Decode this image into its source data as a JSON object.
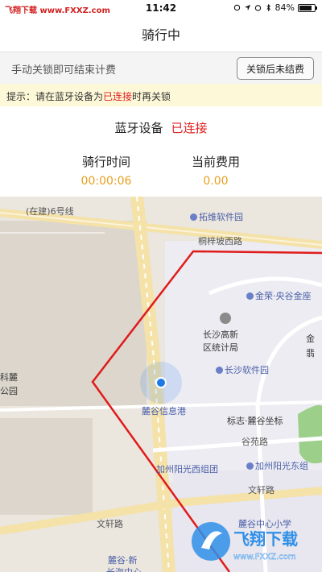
{
  "status_bar": {
    "carrier": "飞翔下载 www.FXXZ.com",
    "time": "11:42",
    "battery_text": "84%",
    "battery_level": 0.84
  },
  "nav": {
    "title": "骑行中"
  },
  "unlock": {
    "hint": "手动关锁即可结束计费",
    "button_label": "关锁后未结费"
  },
  "tip": {
    "prefix": "提示：请在蓝牙设备为",
    "highlight": "已连接",
    "suffix": "时再关锁"
  },
  "bluetooth": {
    "label": "蓝牙设备",
    "status": "已连接"
  },
  "ride": {
    "time_label": "骑行时间",
    "time_value": "00:00:06",
    "fee_label": "当前费用",
    "fee_value": "0.00"
  },
  "map": {
    "labels": {
      "road_6": "(在建)6号线",
      "tuowei": "拓维软件园",
      "tongzi": "桐梓坡西路",
      "jinrong": "金荣·央谷金座",
      "changsha_gx": "长沙高新",
      "district_bureau": "区统计局",
      "jin_partial": "金",
      "fei_partial": "翡",
      "software_park": "长沙软件园",
      "lugu_info": "麓谷信息港",
      "biaozhi": "标志·麓谷坐标",
      "guyuan": "谷苑路",
      "jiazhou_west": "加州阳光西组团",
      "jiazhou_east": "加州阳光东组",
      "wenxuan_right": "文轩路",
      "wenxuan_left": "文轩路",
      "lugu_primary": "麓谷中心小学",
      "lugu_new": "麓谷·新",
      "changhai": "长海中心",
      "ke_partial": "科麓",
      "park_partial": "公园"
    },
    "colors": {
      "fence": "#e01b1b",
      "location": "#1f78e8"
    }
  },
  "watermark": {
    "brand": "飞翔下载",
    "url": "www.FXXZ.com"
  },
  "icons": {
    "location_dot": "location-dot-icon",
    "poi": "poi-icon",
    "watermark_logo": "fxxz-logo-icon"
  }
}
